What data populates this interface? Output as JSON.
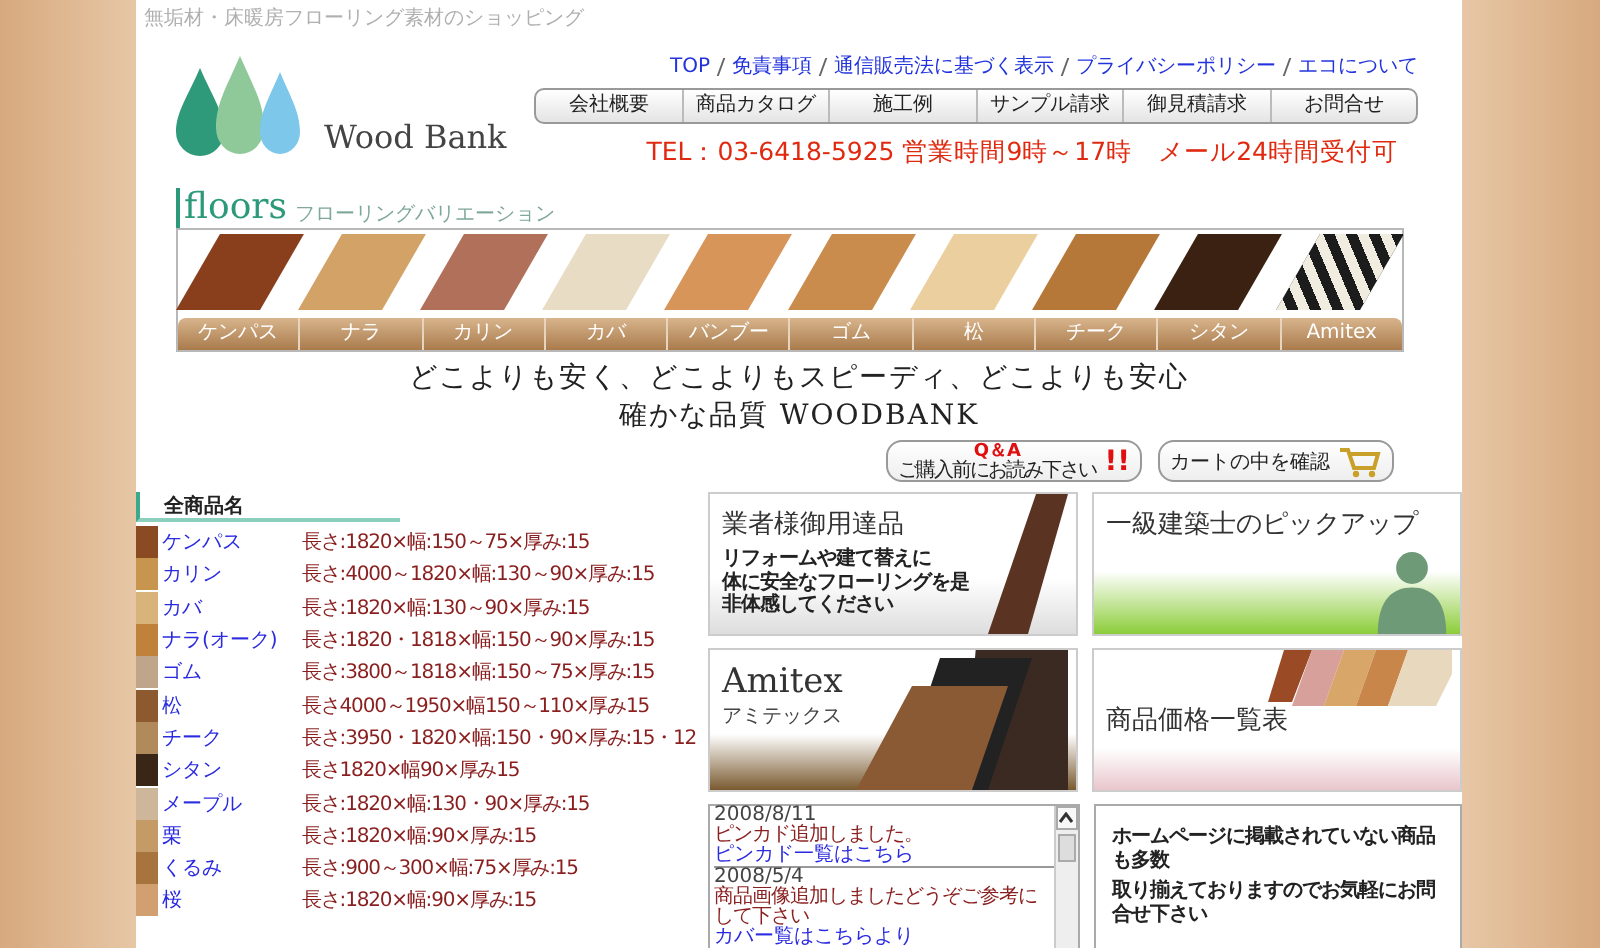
{
  "tagline": "無垢材・床暖房フローリング素材のショッピング",
  "logo": {
    "text": "Wood Bank"
  },
  "top_links": [
    "TOP",
    "免責事項",
    "通信販売法に基づく表示",
    "プライバシーポリシー",
    "エコについて"
  ],
  "nav": [
    "会社概要",
    "商品カタログ",
    "施工例",
    "サンプル請求",
    "御見積請求",
    "お問合せ"
  ],
  "contact": "TEL：03-6418-5925 営業時間9時～17時　メール24時間受付可",
  "floors": {
    "title": "floors",
    "subtitle": "フローリングバリエーション",
    "items": [
      {
        "label": "ケンパス",
        "color": "#8a3f1c",
        "kind": "wood"
      },
      {
        "label": "ナラ",
        "color": "#d3a266",
        "kind": "wood"
      },
      {
        "label": "カリン",
        "color": "#b0705a",
        "kind": "wood"
      },
      {
        "label": "カバ",
        "color": "#e8dcc4",
        "kind": "wood"
      },
      {
        "label": "バンブー",
        "color": "#d8955a",
        "kind": "wood"
      },
      {
        "label": "ゴム",
        "color": "#c98c4c",
        "kind": "wood"
      },
      {
        "label": "松",
        "color": "#eccf9e",
        "kind": "wood"
      },
      {
        "label": "チーク",
        "color": "#b57838",
        "kind": "wood"
      },
      {
        "label": "シタン",
        "color": "#3a2112",
        "kind": "wood"
      },
      {
        "label": "Amitex",
        "color": "#1c1c1c",
        "kind": "pattern"
      }
    ]
  },
  "slogan": [
    "どこよりも安く、どこよりもスピーディ、どこよりも安心",
    "確かな品質 WOODBANK"
  ],
  "qa_button": {
    "title": "Q＆A",
    "subtitle": "ご購入前にお読み下さい",
    "mark": "!!"
  },
  "cart_button": {
    "label": "カートの中を確認"
  },
  "products": {
    "heading": "全商品名",
    "rows": [
      {
        "name": "ケンパス",
        "spec": "長さ:1820×幅:150～75×厚み:15",
        "color": "#8a4a22"
      },
      {
        "name": "カリン",
        "spec": "長さ:4000～1820×幅:130～90×厚み:15",
        "color": "#c8954e"
      },
      {
        "name": "カバ",
        "spec": "長さ:1820×幅:130～90×厚み:15",
        "color": "#d9b47a"
      },
      {
        "name": "ナラ(オーク)",
        "spec": "長さ:1820・1818×幅:150～90×厚み:15",
        "color": "#c0823a"
      },
      {
        "name": "ゴム",
        "spec": "長さ:3800～1818×幅:150～75×厚み:15",
        "color": "#bfa58a"
      },
      {
        "name": "松",
        "spec": "長さ4000～1950×幅150～110×厚み15",
        "color": "#8c5a2e"
      },
      {
        "name": "チーク",
        "spec": "長さ:3950・1820×幅:150・90×厚み:15・12",
        "color": "#b08a5a"
      },
      {
        "name": "シタン",
        "spec": "長さ1820×幅90×厚み15",
        "color": "#3a2616"
      },
      {
        "name": "メープル",
        "spec": "長さ:1820×幅:130・90×厚み:15",
        "color": "#cdb69a"
      },
      {
        "name": "栗",
        "spec": "長さ:1820×幅:90×厚み:15",
        "color": "#c49a66"
      },
      {
        "name": "くるみ",
        "spec": "長さ:900～300×幅:75×厚み:15",
        "color": "#a8743e"
      },
      {
        "name": "桜",
        "spec": "長さ:1820×幅:90×厚み:15",
        "color": "#d2a070"
      }
    ]
  },
  "banners": [
    {
      "kind": "plank",
      "title": "業者様御用達品",
      "lines": [
        "リフォームや建て替えに",
        "体に安全なフローリングを是非体感してください"
      ]
    },
    {
      "kind": "person",
      "title": "一級建築士のピックアップ"
    },
    {
      "kind": "amitex",
      "title": "Amitex",
      "subtitle": "アミテックス"
    },
    {
      "kind": "samples",
      "title": "商品価格一覧表"
    }
  ],
  "news": [
    {
      "date": "2008/8/11",
      "text": "ピンカド追加しました。",
      "link": "ピンカド一覧はこちら"
    },
    {
      "date": "2008/5/4",
      "text": "商品画像追加しましたどうぞご参考にして下さい",
      "link": "カバー覧はこちらより"
    }
  ],
  "info": {
    "lines": [
      "ホームページに掲載されていない商品も多数",
      "取り揃えておりますのでお気軽にお問合せ下さい"
    ]
  }
}
